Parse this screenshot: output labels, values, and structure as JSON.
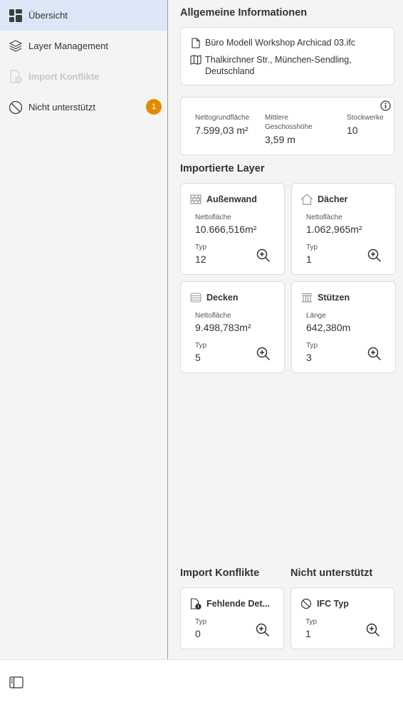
{
  "sidebar": {
    "items": [
      {
        "label": "Übersicht",
        "icon": "dashboard-icon"
      },
      {
        "label": "Layer Management",
        "icon": "layers-icon"
      },
      {
        "label": "Import Konflikte",
        "icon": "file-warning-icon"
      },
      {
        "label": "Nicht unterstützt",
        "icon": "block-icon",
        "badge": "1"
      }
    ]
  },
  "general": {
    "title": "Allgemeine Informationen",
    "filename": "Büro Modell Workshop Archicad 03.ifc",
    "address_line1": "Thalkirchner Str., München-Sendling,",
    "address_line2": "Deutschland"
  },
  "stats": {
    "net_area_label": "Nettogrundfläche",
    "net_area_value": "7.599,03 m²",
    "height_label_1": "Mittlere",
    "height_label_2": "Geschosshöhe",
    "height_value": "3,59 m",
    "floors_label": "Stockwerke",
    "floors_value": "10"
  },
  "layers": {
    "title": "Importierte Layer",
    "items": [
      {
        "name": "Außenwand",
        "metric_label": "Nettofläche",
        "metric_value": "10.666,516m²",
        "type_label": "Typ",
        "type_value": "12"
      },
      {
        "name": "Dächer",
        "metric_label": "Nettofläche",
        "metric_value": "1.062,965m²",
        "type_label": "Typ",
        "type_value": "1"
      },
      {
        "name": "Decken",
        "metric_label": "Nettofläche",
        "metric_value": "9.498,783m²",
        "type_label": "Typ",
        "type_value": "5"
      },
      {
        "name": "Stützen",
        "metric_label": "Länge",
        "metric_value": "642,380m",
        "type_label": "Typ",
        "type_value": "3"
      }
    ]
  },
  "conflicts": {
    "title": "Import Konflikte",
    "card": {
      "name": "Fehlende Det...",
      "type_label": "Typ",
      "type_value": "0"
    }
  },
  "unsupported": {
    "title": "Nicht unterstützt",
    "card": {
      "name": "IFC Typ",
      "type_label": "Typ",
      "type_value": "1"
    }
  },
  "colors": {
    "accent": "#dbe7f6",
    "badge": "#e28b00"
  }
}
